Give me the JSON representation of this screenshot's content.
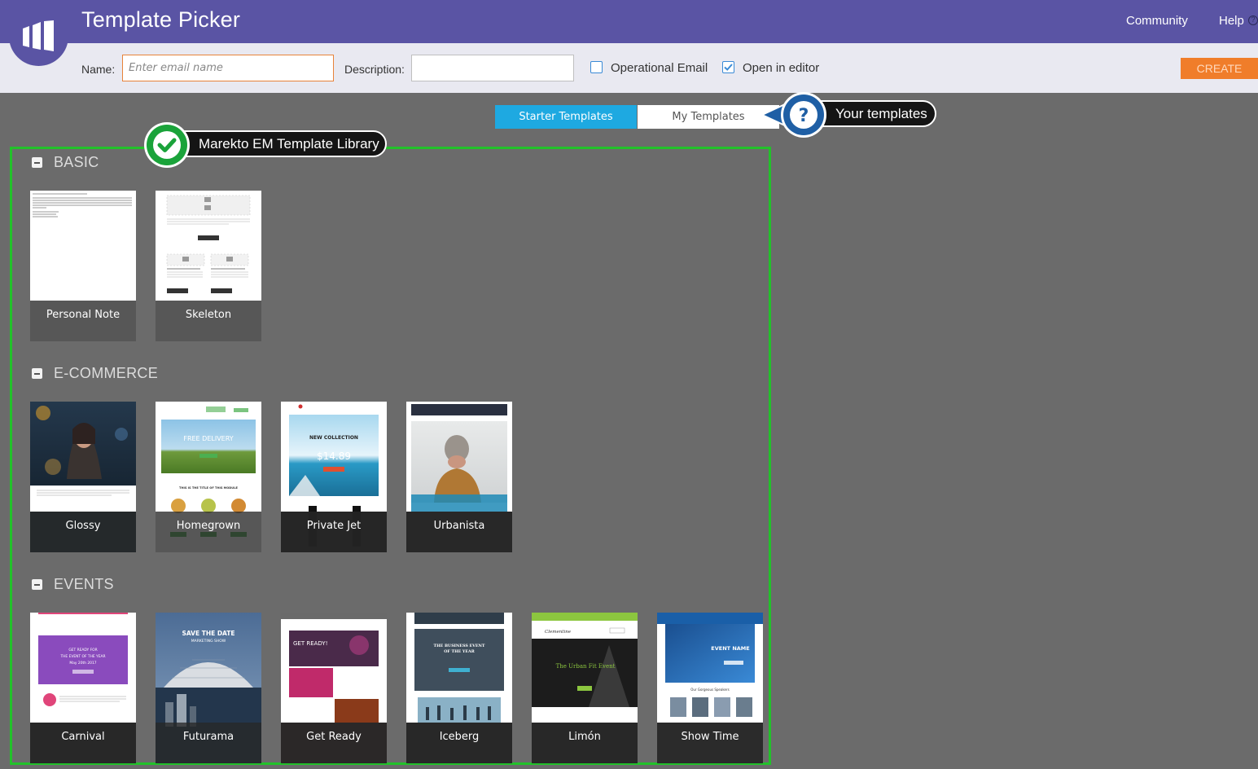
{
  "header": {
    "title": "Template Picker",
    "nav": {
      "community": "Community",
      "help": "Help"
    }
  },
  "form": {
    "name_label": "Name:",
    "name_placeholder": "Enter email name",
    "description_label": "Description:",
    "description_value": "",
    "operational_label": "Operational Email",
    "operational_checked": false,
    "open_editor_label": "Open in editor",
    "open_editor_checked": true,
    "create_label": "CREATE"
  },
  "tabs": [
    {
      "label": "Starter Templates",
      "active": true
    },
    {
      "label": "My Templates",
      "active": false
    }
  ],
  "callouts": {
    "library": "Marekto EM Template Library",
    "your_templates": "Your templates"
  },
  "sections": [
    {
      "title": "BASIC",
      "templates": [
        "Personal Note",
        "Skeleton"
      ]
    },
    {
      "title": "E-COMMERCE",
      "templates": [
        "Glossy",
        "Homegrown",
        "Private Jet",
        "Urbanista"
      ]
    },
    {
      "title": "EVENTS",
      "templates": [
        "Carnival",
        "Futurama",
        "Get Ready",
        "Iceberg",
        "Limón",
        "Show Time"
      ]
    }
  ],
  "thumb_text": {
    "homegrown_hero": "FREE DELIVERY",
    "homegrown_module": "THIS IS THE TITLE OF THIS MODULE",
    "privatejet_heading": "NEW COLLECTION",
    "privatejet_price": "$14.89",
    "carnival_hero": "GET READY FOR THE EVENT OF THE YEAR",
    "carnival_date": "May 20th 2017",
    "futurama_hero": "SAVE THE DATE",
    "futurama_sub": "MARKETING SHOW",
    "getready_hero": "GET READY!",
    "iceberg_hero": "THE BUSINESS EVENT OF THE YEAR",
    "limon_hero": "The Urban Fit Event",
    "limon_brand": "Clementine",
    "showtime_hero": "EVENT NAME",
    "showtime_speakers": "Our Gorgeous Speakers"
  },
  "colors": {
    "header": "#5a54a4",
    "accent_tab": "#1ea9e1",
    "create": "#f07d2a",
    "frame": "#22c12a",
    "background": "#6b6b6b"
  }
}
